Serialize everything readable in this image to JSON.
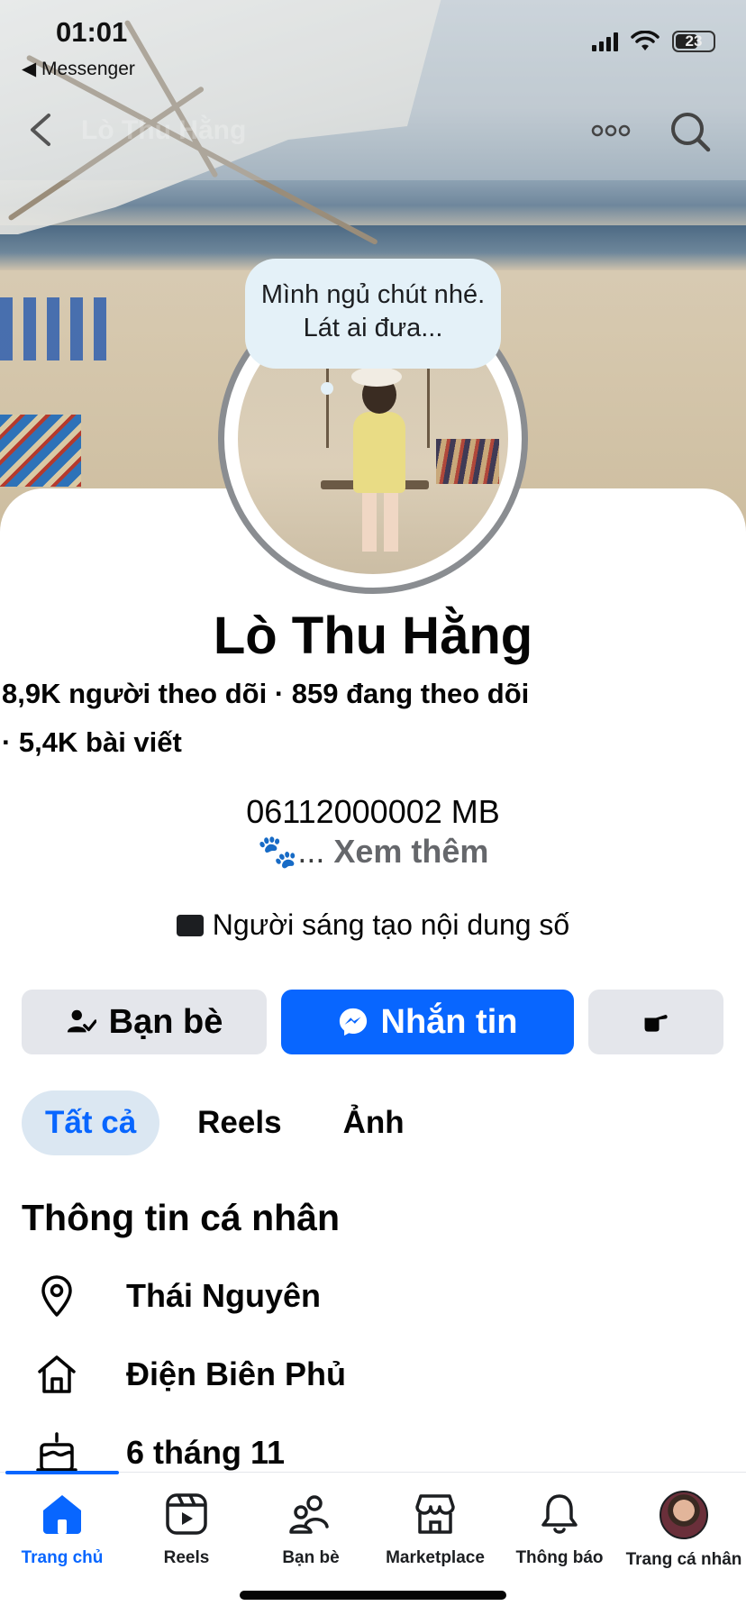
{
  "status_bar": {
    "time": "01:01",
    "back_app": "◀ Messenger",
    "battery": "23"
  },
  "profile": {
    "name": "Lò Thu Hằng",
    "note": "Mình ngủ chút nhé. Lát ai đưa...",
    "stats_line1": "8,9K người theo dõi · 859 đang theo dõi",
    "stats_line2": "· 5,4K bài viết",
    "bio": "06112000002 MB",
    "bio_paw": "🐾...",
    "see_more": "Xem thêm",
    "creator_label": "Người sáng tạo nội dung số"
  },
  "actions": {
    "friends": "Bạn bè",
    "message": "Nhắn tin"
  },
  "tabs": [
    {
      "label": "Tất cả",
      "active": true
    },
    {
      "label": "Reels",
      "active": false
    },
    {
      "label": "Ảnh",
      "active": false
    }
  ],
  "about": {
    "title": "Thông tin cá nhân",
    "items": [
      {
        "icon": "location-pin-icon",
        "label": "Thái Nguyên"
      },
      {
        "icon": "home-icon",
        "label": "Điện Biên Phủ"
      },
      {
        "icon": "birthday-cake-icon",
        "label": "6 tháng 11"
      }
    ]
  },
  "tabbar": [
    {
      "label": "Trang chủ",
      "icon": "home-icon",
      "active": true
    },
    {
      "label": "Reels",
      "icon": "reels-icon",
      "active": false
    },
    {
      "label": "Bạn bè",
      "icon": "friends-icon",
      "active": false
    },
    {
      "label": "Marketplace",
      "icon": "marketplace-icon",
      "active": false
    },
    {
      "label": "Thông báo",
      "icon": "bell-icon",
      "active": false
    },
    {
      "label": "Trang cá nhân",
      "icon": "profile-avatar",
      "active": false
    }
  ],
  "colors": {
    "accent": "#0866ff",
    "button_gray": "#e4e6eb",
    "active_tab_bg": "#dbe7f2",
    "text": "#050505",
    "muted": "#65676b"
  }
}
